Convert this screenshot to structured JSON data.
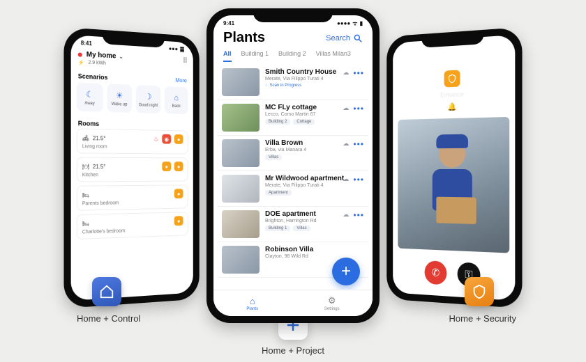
{
  "status_time_left": "8:41",
  "status_time_center": "9:41",
  "left_phone": {
    "home_label": "My home",
    "energy": "2.9 kWh",
    "scenarios_title": "Scenarios",
    "more": "More",
    "scenarios": [
      "Away",
      "Wake up",
      "Good night",
      "Back"
    ],
    "rooms_title": "Rooms",
    "rooms": [
      {
        "temp": "21.5°",
        "name": "Living room"
      },
      {
        "temp": "21.5°",
        "name": "Kitchen"
      },
      {
        "temp": "",
        "name": "Parents bedroom"
      },
      {
        "temp": "",
        "name": "Charlotte's bedroom"
      }
    ]
  },
  "center_phone": {
    "title": "Plants",
    "search": "Search",
    "tabs": [
      "All",
      "Building 1",
      "Building 2",
      "Villas Milan3"
    ],
    "scan": "Scan in Progress",
    "plants": [
      {
        "name": "Smith Country House",
        "addr": "Merate, Via Filippo Turati 4",
        "tags": [],
        "scan": true
      },
      {
        "name": "MC FLy cottage",
        "addr": "Lecco, Corso Martiri 67",
        "tags": [
          "Building 2",
          "Cottage"
        ]
      },
      {
        "name": "Villa Brown",
        "addr": "Erba, via Manara 4",
        "tags": [
          "Villas"
        ]
      },
      {
        "name": "Mr Wildwood apartment",
        "addr": "Merate, Via Filippo Turati 4",
        "tags": [
          "Apartment"
        ]
      },
      {
        "name": "DOE apartment",
        "addr": "Brighton, Harrington Rd",
        "tags": [
          "Building 1",
          "Villas"
        ]
      },
      {
        "name": "Robinson Villa",
        "addr": "Clayton, 98 Wild Rd",
        "tags": []
      }
    ],
    "bottom": {
      "plants": "Plants",
      "settings": "Settings"
    }
  },
  "right_phone": {
    "label": "Entrance"
  },
  "captions": {
    "left": "Home + Control",
    "center": "Home + Project",
    "right": "Home + Security"
  }
}
